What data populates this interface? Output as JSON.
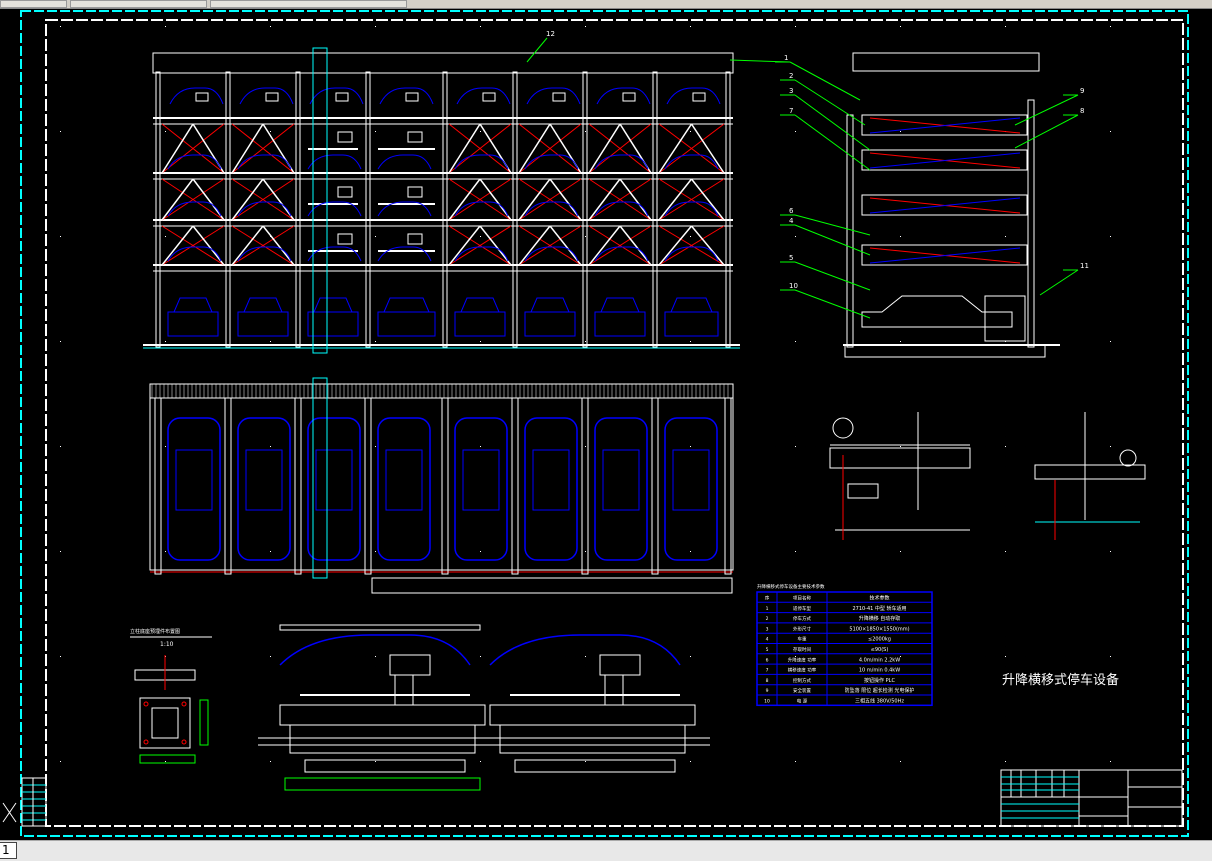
{
  "drawing": {
    "title": "升降横移式停车设备",
    "callouts": [
      "1",
      "2",
      "3",
      "4",
      "5",
      "6",
      "7",
      "8",
      "9",
      "10",
      "11",
      "12"
    ],
    "spec_table": {
      "caption": "升降横移式停车设备主要技术参数",
      "header": [
        "序",
        "项目名称",
        "技术参数"
      ],
      "rows": [
        [
          "1",
          "适停车型",
          "2710-41 中型 轿车适用"
        ],
        [
          "2",
          "停车方式",
          "升降横移 自动存取"
        ],
        [
          "3",
          "外形尺寸",
          "5100×1850×1550(mm)"
        ],
        [
          "4",
          "车重",
          "≤2000kg"
        ],
        [
          "5",
          "存取时间",
          "≤90(S)"
        ],
        [
          "6",
          "升降速度 功率",
          "4.0m/min 2.2kW"
        ],
        [
          "7",
          "横移速度 功率",
          "10 m/min 0.4kW"
        ],
        [
          "8",
          "控制方式",
          "按钮操作 PLC"
        ],
        [
          "9",
          "安全装置",
          "防坠落 限位 超长检测 光电保护"
        ],
        [
          "10",
          "电 源",
          "三相五线 380V/50Hz"
        ]
      ]
    },
    "section_label": "1:10",
    "section_caption": "立柱底座预埋件布置图"
  },
  "status": {
    "layout_tab": "1"
  },
  "colors": {
    "background": "#000000",
    "frame": "#00ffff",
    "line": "#ffffff",
    "car": "#0000ff",
    "brace": "#ff0000",
    "leader": "#00ff00",
    "table": "#0000ff"
  }
}
